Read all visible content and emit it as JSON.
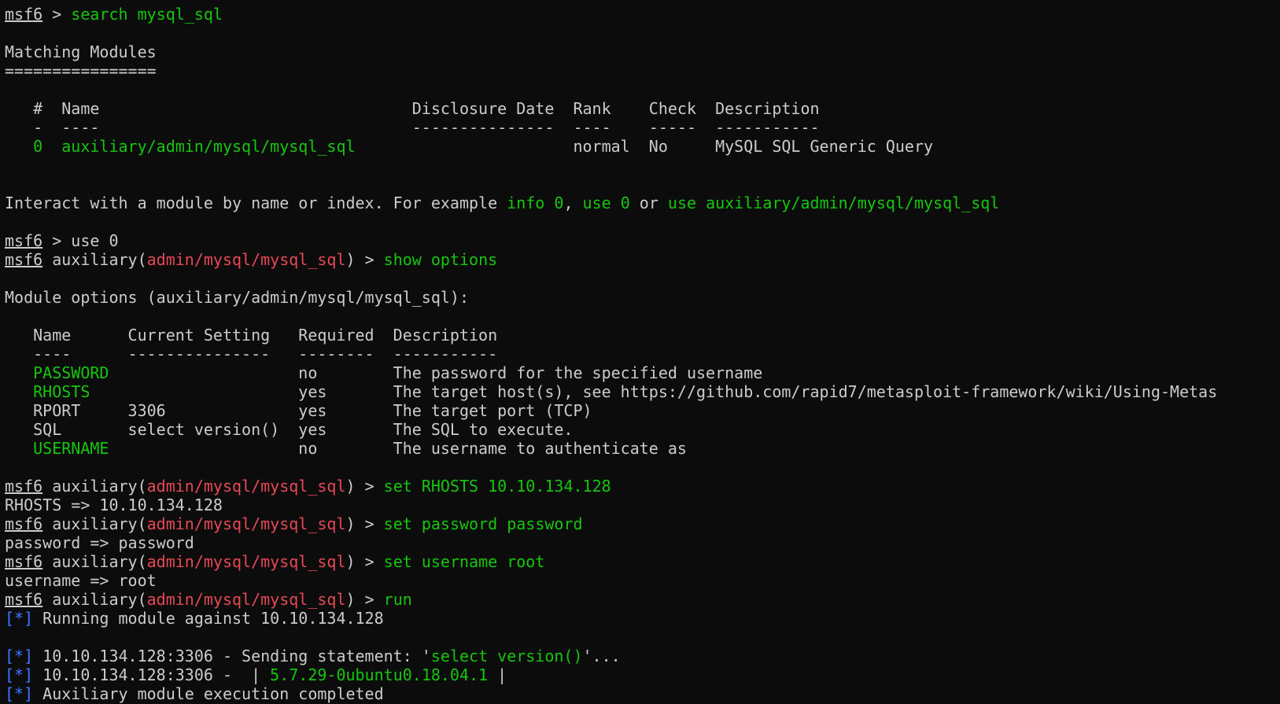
{
  "terminal": {
    "lines": [
      {
        "segs": [
          {
            "t": "msf6",
            "c": "u"
          },
          {
            "t": " > "
          },
          {
            "t": "search mysql_sql",
            "c": "g"
          }
        ]
      },
      {
        "segs": []
      },
      {
        "segs": [
          {
            "t": "Matching Modules"
          }
        ]
      },
      {
        "segs": [
          {
            "t": "================"
          }
        ]
      },
      {
        "segs": []
      },
      {
        "segs": [
          {
            "t": "   #  Name                                 Disclosure Date  Rank    Check  Description"
          }
        ]
      },
      {
        "segs": [
          {
            "t": "   -  ----                                 ---------------  ----    -----  -----------"
          }
        ]
      },
      {
        "segs": [
          {
            "t": "   "
          },
          {
            "t": "0  auxiliary/admin/mysql/mysql_sql",
            "c": "g"
          },
          {
            "t": "                       normal  No     MySQL SQL Generic Query"
          }
        ]
      },
      {
        "segs": []
      },
      {
        "segs": []
      },
      {
        "segs": [
          {
            "t": "Interact with a module by name or index. For example "
          },
          {
            "t": "info 0",
            "c": "g"
          },
          {
            "t": ", "
          },
          {
            "t": "use 0",
            "c": "g"
          },
          {
            "t": " or "
          },
          {
            "t": "use auxiliary/admin/mysql/mysql_sql",
            "c": "g"
          }
        ]
      },
      {
        "segs": []
      },
      {
        "segs": [
          {
            "t": "msf6",
            "c": "u"
          },
          {
            "t": " > use 0"
          }
        ]
      },
      {
        "segs": [
          {
            "t": "msf6",
            "c": "u"
          },
          {
            "t": " auxiliary("
          },
          {
            "t": "admin/mysql/mysql_sql",
            "c": "r"
          },
          {
            "t": ") > "
          },
          {
            "t": "show options",
            "c": "g"
          }
        ]
      },
      {
        "segs": []
      },
      {
        "segs": [
          {
            "t": "Module options (auxiliary/admin/mysql/mysql_sql):"
          }
        ]
      },
      {
        "segs": []
      },
      {
        "segs": [
          {
            "t": "   Name      Current Setting   Required  Description"
          }
        ]
      },
      {
        "segs": [
          {
            "t": "   ----      ---------------   --------  -----------"
          }
        ]
      },
      {
        "segs": [
          {
            "t": "   "
          },
          {
            "t": "PASSWORD",
            "c": "g"
          },
          {
            "t": "                    no        The password for the specified username"
          }
        ]
      },
      {
        "segs": [
          {
            "t": "   "
          },
          {
            "t": "RHOSTS",
            "c": "g"
          },
          {
            "t": "                      yes       The target host(s), see https://github.com/rapid7/metasploit-framework/wiki/Using-Metas"
          }
        ]
      },
      {
        "segs": [
          {
            "t": "   RPORT     3306              yes       The target port (TCP)"
          }
        ]
      },
      {
        "segs": [
          {
            "t": "   SQL       select version()  yes       The SQL to execute."
          }
        ]
      },
      {
        "segs": [
          {
            "t": "   "
          },
          {
            "t": "USERNAME",
            "c": "g"
          },
          {
            "t": "                    no        The username to authenticate as"
          }
        ]
      },
      {
        "segs": []
      },
      {
        "segs": [
          {
            "t": "msf6",
            "c": "u"
          },
          {
            "t": " auxiliary("
          },
          {
            "t": "admin/mysql/mysql_sql",
            "c": "r"
          },
          {
            "t": ") > "
          },
          {
            "t": "set RHOSTS 10.10.134.128",
            "c": "g"
          }
        ]
      },
      {
        "segs": [
          {
            "t": "RHOSTS => 10.10.134.128"
          }
        ]
      },
      {
        "segs": [
          {
            "t": "msf6",
            "c": "u"
          },
          {
            "t": " auxiliary("
          },
          {
            "t": "admin/mysql/mysql_sql",
            "c": "r"
          },
          {
            "t": ") > "
          },
          {
            "t": "set password password",
            "c": "g"
          }
        ]
      },
      {
        "segs": [
          {
            "t": "password => password"
          }
        ]
      },
      {
        "segs": [
          {
            "t": "msf6",
            "c": "u"
          },
          {
            "t": " auxiliary("
          },
          {
            "t": "admin/mysql/mysql_sql",
            "c": "r"
          },
          {
            "t": ") > "
          },
          {
            "t": "set username root",
            "c": "g"
          }
        ]
      },
      {
        "segs": [
          {
            "t": "username => root"
          }
        ]
      },
      {
        "segs": [
          {
            "t": "msf6",
            "c": "u"
          },
          {
            "t": " auxiliary("
          },
          {
            "t": "admin/mysql/mysql_sql",
            "c": "r"
          },
          {
            "t": ") > "
          },
          {
            "t": "run",
            "c": "g"
          }
        ]
      },
      {
        "segs": [
          {
            "t": "[*]",
            "c": "b"
          },
          {
            "t": " Running module against 10.10.134.128"
          }
        ]
      },
      {
        "segs": []
      },
      {
        "segs": [
          {
            "t": "[*]",
            "c": "b"
          },
          {
            "t": " 10.10.134.128:3306 - Sending statement: '"
          },
          {
            "t": "select version()",
            "c": "g"
          },
          {
            "t": "'..."
          }
        ]
      },
      {
        "segs": [
          {
            "t": "[*]",
            "c": "b"
          },
          {
            "t": " 10.10.134.128:3306 -  | "
          },
          {
            "t": "5.7.29-0ubuntu0.18.04.1",
            "c": "g"
          },
          {
            "t": " |"
          }
        ]
      },
      {
        "segs": [
          {
            "t": "[*]",
            "c": "b"
          },
          {
            "t": " Auxiliary module execution completed"
          }
        ]
      }
    ]
  },
  "colors": {
    "background": "#0c0c0c",
    "foreground": "#cccccc",
    "green": "#16c60c",
    "red": "#e74856",
    "blue": "#3b78ff"
  }
}
